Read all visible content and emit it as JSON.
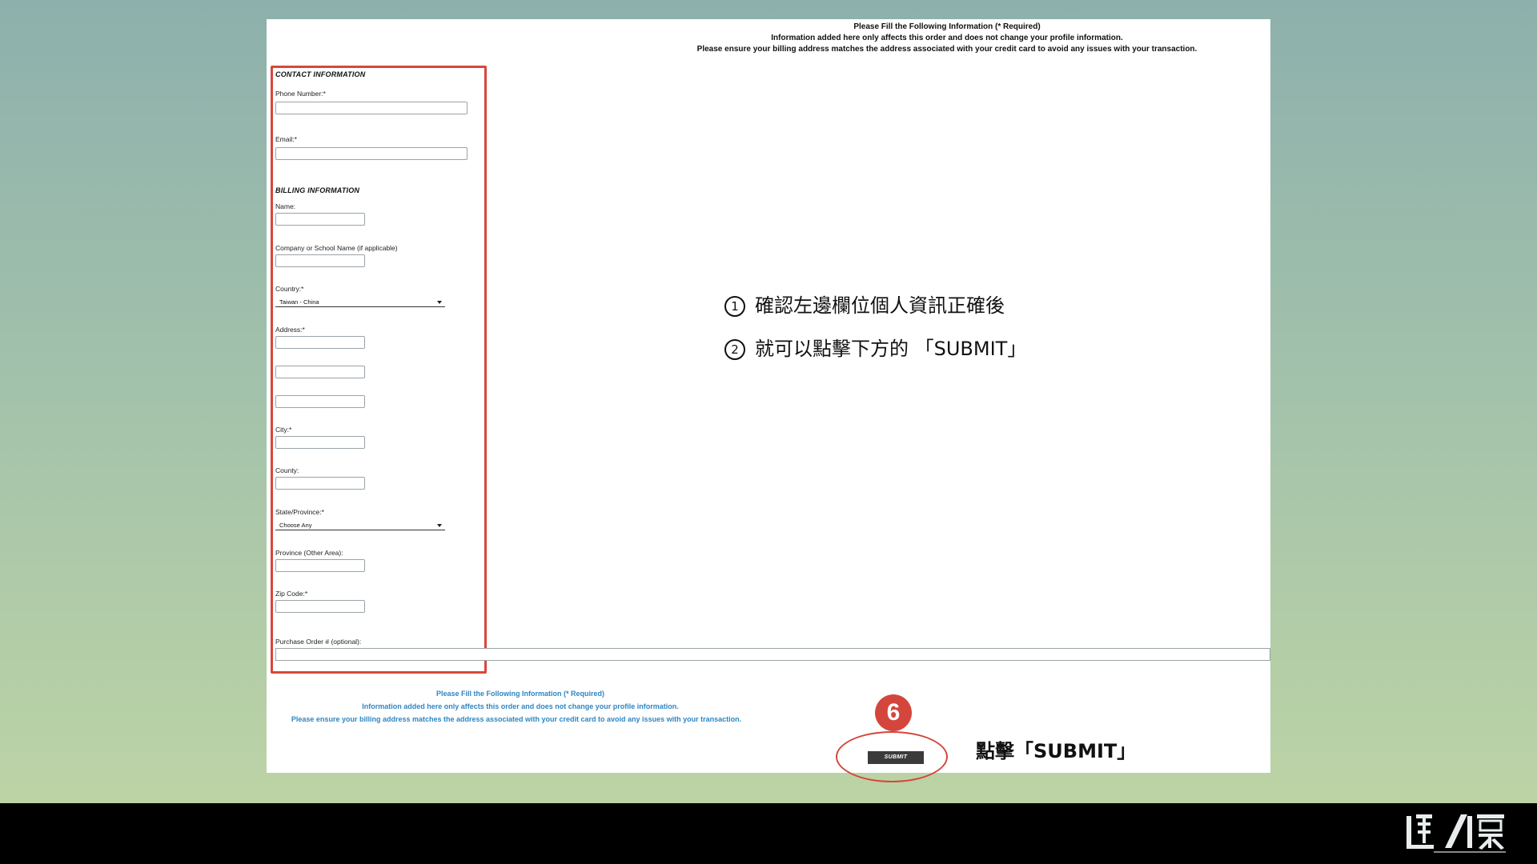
{
  "header": {
    "line1": "Please Fill the Following Information (* Required)",
    "line2": "Information added here only affects this order and does not change your profile information.",
    "line3": "Please ensure your billing address matches the address associated with your credit card to avoid any issues with your transaction."
  },
  "contact": {
    "title": "CONTACT INFORMATION",
    "phone_label": "Phone Number:*",
    "email_label": "Email:*"
  },
  "billing": {
    "title": "BILLING INFORMATION",
    "name_label": "Name:",
    "company_label": "Company or School Name (if applicable)",
    "country_label": "Country:*",
    "country_value": "Taiwan - China",
    "address_label": "Address:*",
    "city_label": "City:*",
    "county_label": "County:",
    "state_label": "State/Province:*",
    "state_value": "Choose Any",
    "province_other_label": "Province (Other Area):",
    "zip_label": "Zip Code:*",
    "po_label": "Purchase Order # (optional):"
  },
  "footer": {
    "line1": "Please Fill the Following Information (* Required)",
    "line2": "Information added here only affects this order and does not change your profile information.",
    "line3": "Please ensure your billing address matches the address associated with your credit card to avoid any issues with your transaction."
  },
  "submit_label": "SUBMIT",
  "annotations": {
    "step1_num": "1",
    "step1_text": "確認左邊欄位個人資訊正確後",
    "step2_num": "2",
    "step2_text": "就可以點擊下方的 「SUBMIT」",
    "step_badge": "6",
    "click_text": "點擊「SUBMIT」"
  },
  "colors": {
    "highlight_red": "#d8463c",
    "footer_blue": "#2d86c4",
    "button_dark": "#3b3b3b"
  }
}
